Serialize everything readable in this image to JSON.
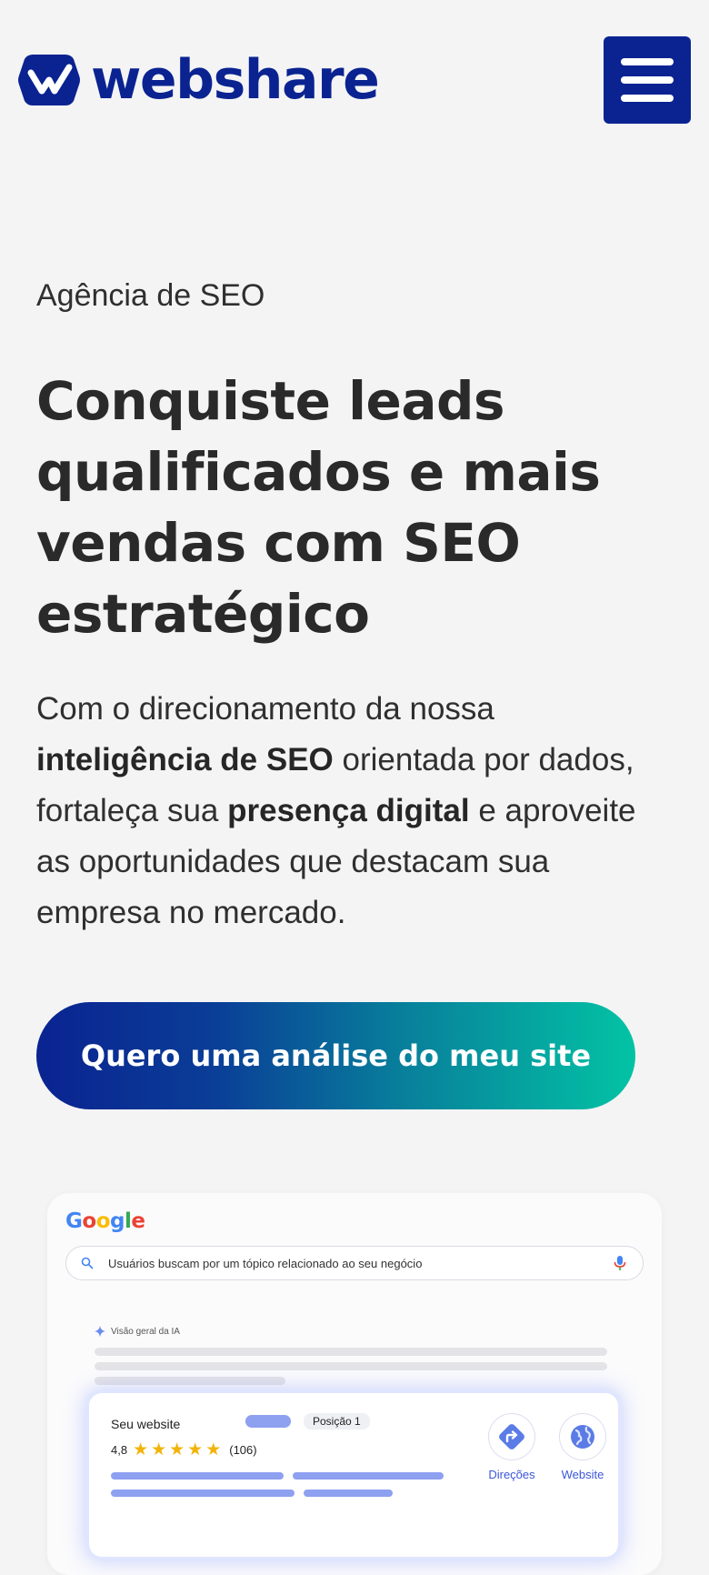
{
  "header": {
    "brand": "webshare",
    "menu_label": "Menu"
  },
  "hero": {
    "eyebrow": "Agência de SEO",
    "headline": "Conquiste leads qualificados e mais vendas com SEO estratégico",
    "lead": {
      "p1": "Com o direcionamento da nossa ",
      "b1": "inteligência de SEO",
      "p2": " orientada por dados, fortaleça sua ",
      "b2": "presença digital",
      "p3": " e aproveite as oportunidades que destacam sua empresa no mercado."
    },
    "cta_label": "Quero uma análise do meu site"
  },
  "mockup": {
    "google": [
      "G",
      "o",
      "o",
      "g",
      "l",
      "e"
    ],
    "search_query": "Usuários buscam por um tópico relacionado ao seu negócio",
    "ai_overview": "Visão geral da IA",
    "result": {
      "title": "Seu website",
      "position": "Posição 1",
      "rating": "4,8",
      "stars": "★★★★★",
      "reviews": "(106)",
      "action_directions": "Direções",
      "action_website": "Website"
    }
  },
  "colors": {
    "brand": "#0a2391",
    "accent_gradient_end": "#03c3a4",
    "star": "#f2b40b",
    "link": "#3b57d8"
  }
}
